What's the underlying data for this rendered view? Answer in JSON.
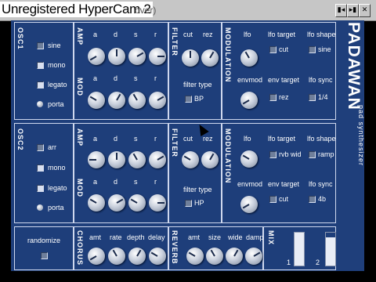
{
  "window": {
    "title": "Unregistered HyperCam 2",
    "faded_title": "over)",
    "buttons": [
      "min",
      "max",
      "close"
    ]
  },
  "brand": {
    "name": "PADAWAN",
    "subtitle": "pad synthesizer"
  },
  "osc1": {
    "section": "OSC1",
    "options": [
      {
        "label": "sine",
        "state": "off"
      },
      {
        "label": "mono",
        "state": "on"
      },
      {
        "label": "legato",
        "state": "on"
      },
      {
        "label": "porta",
        "state": "dot"
      }
    ],
    "amp": {
      "label": "AMP",
      "knobs": [
        "a",
        "d",
        "s",
        "r"
      ]
    },
    "mod": {
      "label": "MOD",
      "knobs": [
        "a",
        "d",
        "s",
        "r"
      ]
    },
    "filter": {
      "label": "FILTER",
      "knobs": [
        "cut",
        "rez"
      ],
      "filter_type_label": "filter type",
      "filter_type_value": "BP"
    },
    "modulation": {
      "label": "MODULATION",
      "lfo": "lfo",
      "envmod": "envmod",
      "lfo_target_label": "lfo target",
      "lfo_target_value": "cut",
      "env_target_label": "env target",
      "env_target_value": "rez",
      "lfo_shape_label": "lfo shape",
      "lfo_shape_value": "sine",
      "lfo_sync_label": "lfo sync",
      "lfo_sync_value": "1/4"
    }
  },
  "osc2": {
    "section": "OSC2",
    "options": [
      {
        "label": "arr",
        "state": "off"
      },
      {
        "label": "mono",
        "state": "on"
      },
      {
        "label": "legato",
        "state": "on"
      },
      {
        "label": "porta",
        "state": "dot"
      }
    ],
    "amp": {
      "label": "AMP",
      "knobs": [
        "a",
        "d",
        "s",
        "r"
      ]
    },
    "mod": {
      "label": "MOD",
      "knobs": [
        "a",
        "d",
        "s",
        "r"
      ]
    },
    "filter": {
      "label": "FILTER",
      "knobs": [
        "cut",
        "rez"
      ],
      "filter_type_label": "filter type",
      "filter_type_value": "HP"
    },
    "modulation": {
      "label": "MODULATION",
      "lfo": "lfo",
      "envmod": "envmod",
      "lfo_target_label": "lfo target",
      "lfo_target_value": "rvb wid",
      "env_target_label": "env target",
      "env_target_value": "cut",
      "lfo_shape_label": "lfo shape",
      "lfo_shape_value": "ramp",
      "lfo_sync_label": "lfo sync",
      "lfo_sync_value": "4b"
    }
  },
  "bottom": {
    "randomize": "randomize",
    "chorus": {
      "label": "CHORUS",
      "knobs": [
        "amt",
        "rate",
        "depth",
        "delay"
      ]
    },
    "reverb": {
      "label": "REVERB",
      "knobs": [
        "amt",
        "size",
        "wide",
        "damp"
      ]
    },
    "mix": {
      "label": "MIX",
      "ch1": "1",
      "ch2": "2"
    }
  }
}
